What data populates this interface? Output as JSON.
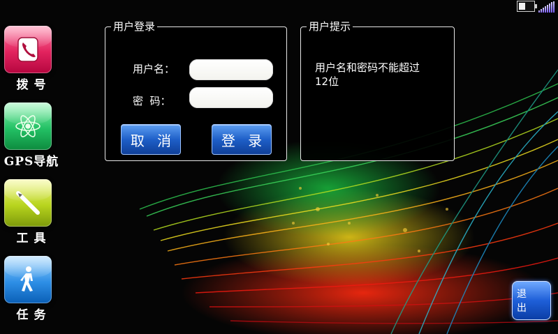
{
  "nav": {
    "items": [
      {
        "label": "拨 号",
        "icon": "phone-icon",
        "color": "#e2235e"
      },
      {
        "label": "GPS导航",
        "icon": "atom-icon",
        "color": "#23c165"
      },
      {
        "label": "工 具",
        "icon": "pencil-icon",
        "color": "#b8d41e"
      },
      {
        "label": "任 务",
        "icon": "walking-person-icon",
        "color": "#2e8fe6"
      }
    ]
  },
  "login": {
    "legend": "用户登录",
    "username_label": "用户名：",
    "username_value": "",
    "password_label": "密  码：",
    "password_value": "",
    "cancel_label": "取 消",
    "login_label": "登 录"
  },
  "hint": {
    "legend": "用户提示",
    "line1": "用户名和密码不能超过",
    "line2": "12位"
  },
  "exit_label": "退 出",
  "status": {
    "battery_icon": "battery-icon",
    "signal_icon": "signal-icon"
  }
}
